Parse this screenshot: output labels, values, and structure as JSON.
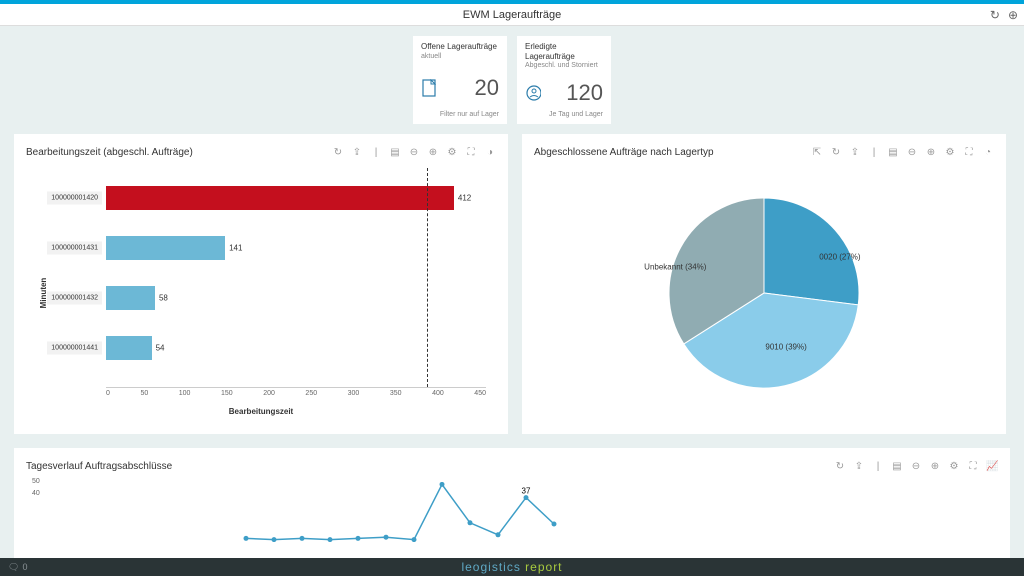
{
  "header": {
    "title": "EWM Lageraufträge"
  },
  "tiles": [
    {
      "title": "Offene Lageraufträge",
      "subtitle": "aktuell",
      "value": "20",
      "footer": "Filter nur auf Lager",
      "icon": "document-icon",
      "icon_color": "#2b7caa"
    },
    {
      "title": "Erledigte Lageraufträge",
      "subtitle": "Abgeschl. und Storniert",
      "value": "120",
      "footer": "Je Tag und Lager",
      "icon": "circle-badge-icon",
      "icon_color": "#2b7caa"
    }
  ],
  "panel_bar": {
    "title": "Bearbeitungszeit (abgeschl. Aufträge)",
    "xlabel": "Bearbeitungszeit",
    "ylabel": "Minuten"
  },
  "panel_pie": {
    "title": "Abgeschlossene Aufträge nach Lagertyp"
  },
  "panel_line": {
    "title": "Tagesverlauf Auftragsabschlüsse"
  },
  "footer": {
    "notif_count": "0",
    "brand_a": "leogistics",
    "brand_b": "report"
  },
  "colors": {
    "bar_blue": "#6cb8d6",
    "bar_red": "#c40f1e",
    "pie_mid": "#3e9ec7",
    "pie_light": "#8accea",
    "pie_grey": "#90acb2"
  },
  "chart_data": [
    {
      "type": "bar",
      "orientation": "horizontal",
      "title": "Bearbeitungszeit (abgeschl. Aufträge)",
      "xlabel": "Bearbeitungszeit",
      "ylabel": "Minuten",
      "xlim": [
        0,
        450
      ],
      "x_ticks": [
        0,
        50,
        100,
        150,
        200,
        250,
        300,
        350,
        400,
        450
      ],
      "threshold": 380,
      "categories": [
        "100000001420",
        "100000001431",
        "100000001432",
        "100000001441"
      ],
      "values": [
        412,
        141,
        58,
        54
      ],
      "colors": [
        "#c40f1e",
        "#6cb8d6",
        "#6cb8d6",
        "#6cb8d6"
      ]
    },
    {
      "type": "pie",
      "title": "Abgeschlossene Aufträge nach Lagertyp",
      "series": [
        {
          "name": "0020",
          "value": 27,
          "label": "0020 (27%)",
          "color": "#3e9ec7"
        },
        {
          "name": "9010",
          "value": 39,
          "label": "9010 (39%)",
          "color": "#8accea"
        },
        {
          "name": "Unbekannt",
          "value": 34,
          "label": "Unbekannt (34%)",
          "color": "#90acb2"
        }
      ]
    },
    {
      "type": "line",
      "title": "Tagesverlauf Auftragsabschlüsse",
      "ylim": [
        0,
        50
      ],
      "y_ticks": [
        40,
        50
      ],
      "values": [
        3,
        2,
        3,
        2,
        3,
        4,
        2,
        48,
        16,
        6,
        37,
        15
      ],
      "annotations": [
        {
          "index": 10,
          "text": "37"
        }
      ],
      "color": "#3e9ec7"
    }
  ]
}
